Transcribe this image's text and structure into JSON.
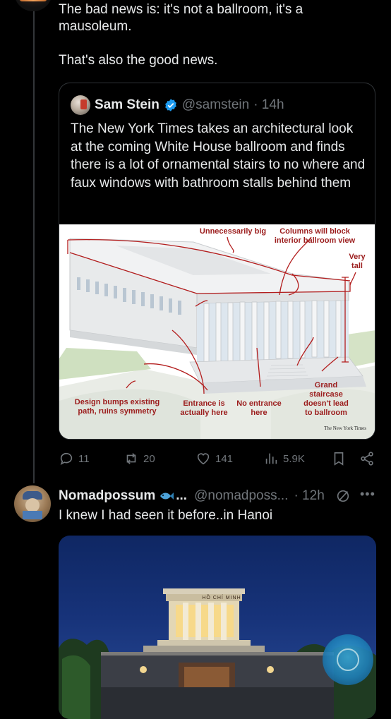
{
  "parent_tweet": {
    "text": "The bad news is: it's not a ballroom, it's a mausoleum.\n\nThat's also the good news."
  },
  "quote": {
    "name": "Sam Stein",
    "handle": "@samstein",
    "time": "· 14h",
    "text": "The New York Times takes an architectural look at the coming White House ballroom and finds there is a lot of ornamental stairs to no where and faux windows with bathroom stalls behind them",
    "image_annotations": {
      "unnecessarily_big": "Unnecessarily big",
      "columns": "Columns will block interior ballroom view",
      "very_tall": "Very tall",
      "design_bumps": "Design bumps existing path, ruins symmetry",
      "entrance": "Entrance is actually here",
      "no_entrance": "No entrance here",
      "grand_staircase": "Grand staircase doesn't lead to ballroom",
      "credit": "The New York Times"
    }
  },
  "actions": {
    "replies": "11",
    "reposts": "20",
    "likes": "141",
    "views": "5.9K"
  },
  "reply": {
    "name": "Nomadpossum",
    "name_suffix": "...",
    "handle": "@nomadposs...",
    "time": "· 12h",
    "text": "I knew I had seen it before..in Hanoi",
    "photo_sign": "HỒ CHÍ MINH",
    "more": "•••"
  },
  "colors": {
    "background": "#000000",
    "text": "#e7e9ea",
    "muted": "#71767b",
    "border": "#2f3336",
    "verified": "#1d9bf0",
    "annotation": "#9b1c1c"
  }
}
